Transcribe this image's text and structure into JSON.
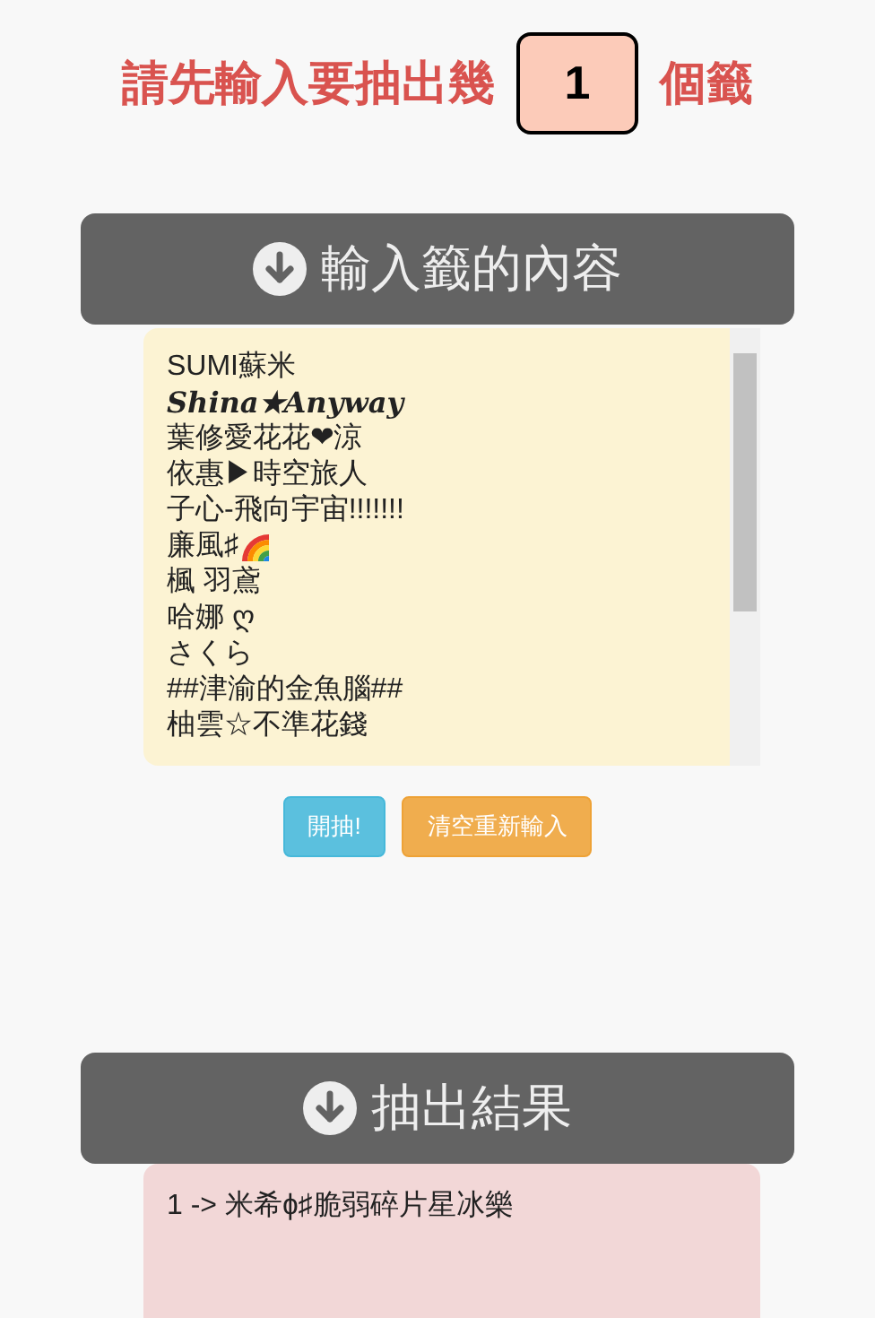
{
  "prompt": {
    "before": "請先輸入要抽出幾",
    "count": "1",
    "after": "個籤"
  },
  "input_section": {
    "title": "輸入籤的內容",
    "lines": [
      {
        "kind": "plain",
        "text": "SUMI蘇米"
      },
      {
        "kind": "bold-italic",
        "text": "Shina★Anyway"
      },
      {
        "kind": "plain",
        "text": "葉修愛花花❤涼"
      },
      {
        "kind": "plain",
        "text": "依惠▶時空旅人"
      },
      {
        "kind": "plain",
        "text": "子心-飛向宇宙!!!!!!!"
      },
      {
        "kind": "rainbow",
        "text": "廉風♯"
      },
      {
        "kind": "plain",
        "text": "楓 羽鳶"
      },
      {
        "kind": "plain",
        "text": "哈娜 ღ"
      },
      {
        "kind": "plain",
        "text": "さくら"
      },
      {
        "kind": "plain",
        "text": "##津渝的金魚腦##"
      },
      {
        "kind": "plain",
        "text": "柚雲☆不準花錢"
      }
    ]
  },
  "buttons": [
    {
      "kind": "info",
      "label": "開抽!"
    },
    {
      "kind": "warning",
      "label": "清空重新輸入"
    }
  ],
  "result_section": {
    "title": "抽出結果",
    "results": [
      "1 -> 米希ɸ♯脆弱碎片星冰樂"
    ]
  }
}
